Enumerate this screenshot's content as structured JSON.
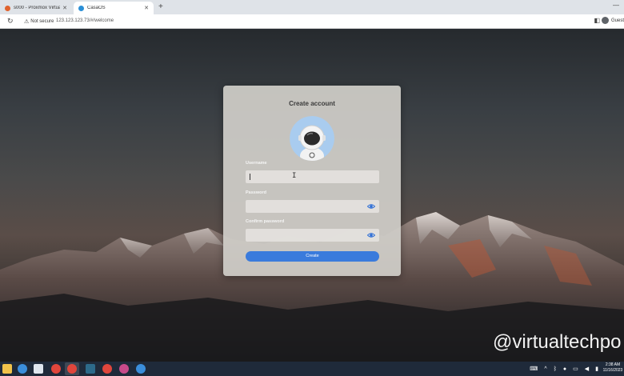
{
  "browser": {
    "tabs": [
      {
        "label": "s000 - Proxmox Virtual Environ",
        "active": false
      },
      {
        "label": "CasaOS",
        "active": true
      }
    ],
    "security_label": "Not secure",
    "url": "123.123.123.73/#/welcome",
    "profile_label": "Guest"
  },
  "dialog": {
    "title": "Create account",
    "username_label": "Username",
    "username_value": "",
    "password_label": "Password",
    "password_value": "",
    "confirm_label": "Confirm password",
    "confirm_value": "",
    "create_label": "Create"
  },
  "watermark": "@virtualtechpo",
  "taskbar": {
    "time": "2:38 AM",
    "date": "11/16/2023"
  },
  "colors": {
    "accent": "#3a7bdc",
    "eye": "#2f6fd6"
  }
}
